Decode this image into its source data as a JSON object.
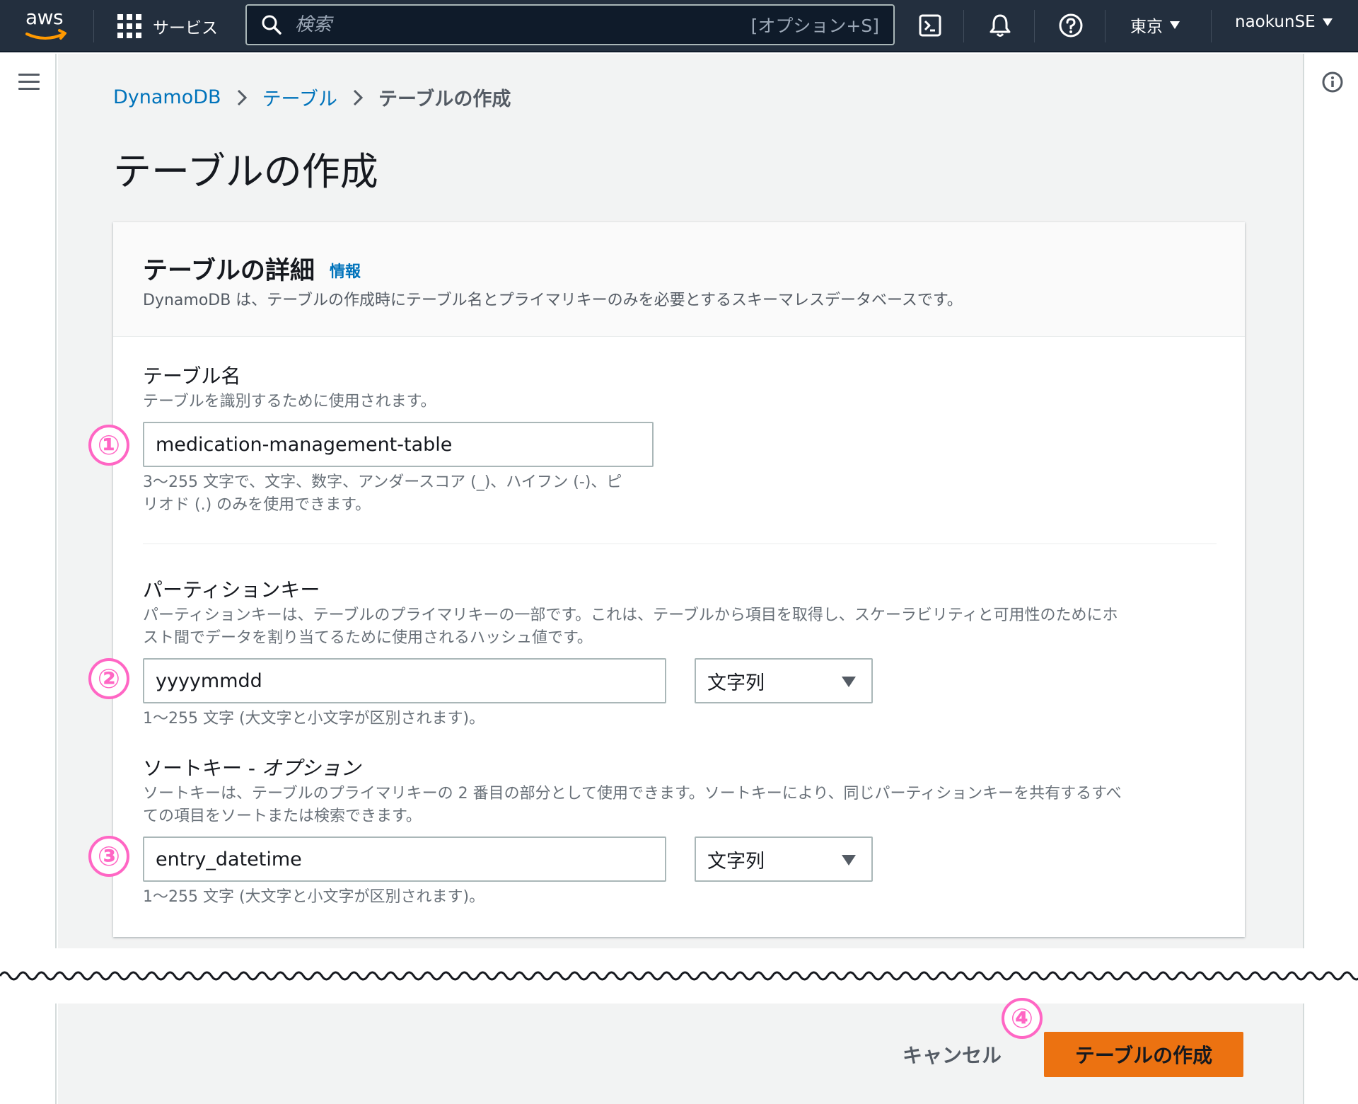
{
  "nav": {
    "logo_text": "aws",
    "services_label": "サービス",
    "search_placeholder": "検索",
    "search_shortcut": "[オプション+S]",
    "region_label": "東京",
    "account_label": "naokunSE"
  },
  "breadcrumb": {
    "items": [
      "DynamoDB",
      "テーブル"
    ],
    "current": "テーブルの作成"
  },
  "page": {
    "title": "テーブルの作成"
  },
  "panel": {
    "title": "テーブルの詳細",
    "info_link": "情報",
    "description": "DynamoDB は、テーブルの作成時にテーブル名とプライマリキーのみを必要とするスキーマレスデータベースです。"
  },
  "table_name": {
    "label": "テーブル名",
    "description": "テーブルを識別するために使用されます。",
    "value": "medication-management-table",
    "hint_line1": "3〜255 文字で、文字、数字、アンダースコア (_)、ハイフン (-)、ピ",
    "hint_line2": "リオド (.) のみを使用できます。"
  },
  "partition_key": {
    "label": "パーティションキー",
    "description_line1": "パーティションキーは、テーブルのプライマリキーの一部です。これは、テーブルから項目を取得し、スケーラビリティと可用性のためにホ",
    "description_line2": "スト間でデータを割り当てるために使用されるハッシュ値です。",
    "value": "yyyymmdd",
    "type": "文字列",
    "hint": "1〜255 文字 (大文字と小文字が区別されます)。"
  },
  "sort_key": {
    "label": "ソートキー - ",
    "label_optional": "オプション",
    "description_line1": "ソートキーは、テーブルのプライマリキーの 2 番目の部分として使用できます。ソートキーにより、同じパーティションキーを共有するすべ",
    "description_line2": "ての項目をソートまたは検索できます。",
    "value": "entry_datetime",
    "type": "文字列",
    "hint": "1〜255 文字 (大文字と小文字が区別されます)。"
  },
  "actions": {
    "cancel_label": "キャンセル",
    "create_label": "テーブルの作成"
  },
  "annotations": [
    "①",
    "②",
    "③",
    "④"
  ],
  "colors": {
    "nav_bg": "#232f3e",
    "link": "#0073bb",
    "primary_button": "#ec7211",
    "annotation": "#ff66c4",
    "page_bg": "#f2f3f3"
  }
}
